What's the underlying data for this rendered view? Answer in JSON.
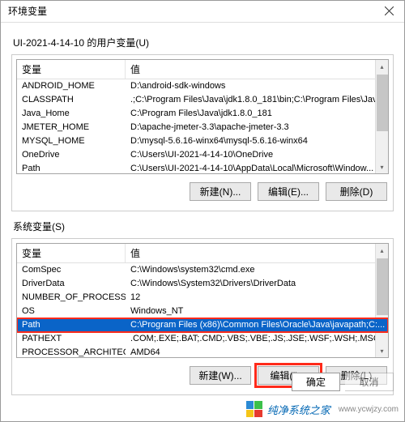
{
  "window": {
    "title": "环境变量"
  },
  "user_section": {
    "label": "UI-2021-4-14-10 的用户变量(U)",
    "header_name": "变量",
    "header_value": "值",
    "rows": [
      {
        "name": "ANDROID_HOME",
        "value": "D:\\android-sdk-windows"
      },
      {
        "name": "CLASSPATH",
        "value": ".;C:\\Program Files\\Java\\jdk1.8.0_181\\bin;C:\\Program Files\\Jav..."
      },
      {
        "name": "Java_Home",
        "value": "C:\\Program Files\\Java\\jdk1.8.0_181"
      },
      {
        "name": "JMETER_HOME",
        "value": "D:\\apache-jmeter-3.3\\apache-jmeter-3.3"
      },
      {
        "name": "MYSQL_HOME",
        "value": "D:\\mysql-5.6.16-winx64\\mysql-5.6.16-winx64"
      },
      {
        "name": "OneDrive",
        "value": "C:\\Users\\UI-2021-4-14-10\\OneDrive"
      },
      {
        "name": "Path",
        "value": "C:\\Users\\UI-2021-4-14-10\\AppData\\Local\\Microsoft\\Window..."
      }
    ],
    "buttons": {
      "new": "新建(N)...",
      "edit": "编辑(E)...",
      "delete": "删除(D)"
    }
  },
  "system_section": {
    "label": "系统变量(S)",
    "header_name": "变量",
    "header_value": "值",
    "rows": [
      {
        "name": "ComSpec",
        "value": "C:\\Windows\\system32\\cmd.exe"
      },
      {
        "name": "DriverData",
        "value": "C:\\Windows\\System32\\Drivers\\DriverData"
      },
      {
        "name": "NUMBER_OF_PROCESSORS",
        "value": "12"
      },
      {
        "name": "OS",
        "value": "Windows_NT"
      },
      {
        "name": "Path",
        "value": "C:\\Program Files (x86)\\Common Files\\Oracle\\Java\\javapath;C:...",
        "selected": true
      },
      {
        "name": "PATHEXT",
        "value": ".COM;.EXE;.BAT;.CMD;.VBS;.VBE;.JS;.JSE;.WSF;.WSH;.MSC"
      },
      {
        "name": "PROCESSOR_ARCHITECT...",
        "value": "AMD64"
      }
    ],
    "buttons": {
      "new": "新建(W)...",
      "edit": "编辑(I)...",
      "delete": "删除(L)"
    }
  },
  "dialog_buttons": {
    "ok": "确定",
    "cancel": "取消"
  },
  "watermark": {
    "brand": "纯净系统之家",
    "url": "www.ycwjzy.com"
  }
}
